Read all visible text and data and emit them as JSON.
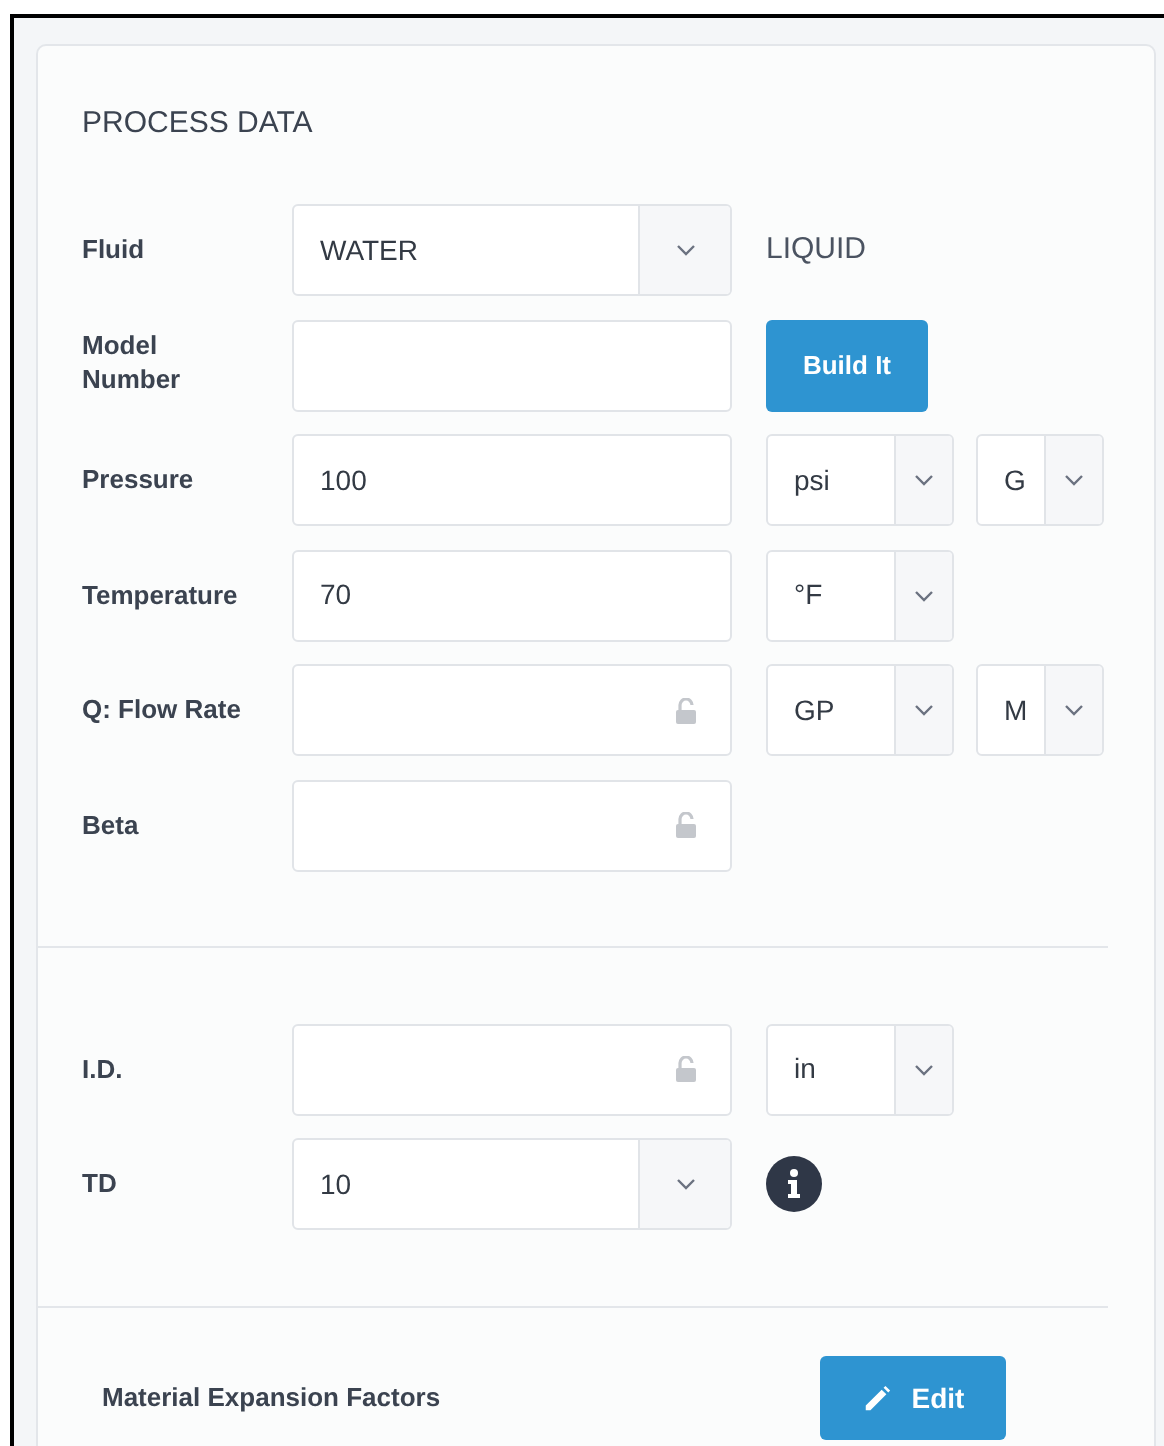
{
  "section_title": "PROCESS DATA",
  "rows": [
    {
      "label": "Fluid",
      "control": {
        "kind": "select",
        "value": "WATER"
      },
      "extras": [
        {
          "kind": "text",
          "text": "LIQUID"
        }
      ]
    },
    {
      "label": "Model Number",
      "control": {
        "kind": "input",
        "locked": false
      },
      "extras": [
        {
          "kind": "button",
          "text": "Build It"
        }
      ]
    },
    {
      "label": "Pressure",
      "control": {
        "kind": "input",
        "value": "100",
        "locked": false
      },
      "extras": [
        {
          "kind": "wide_select",
          "value": "psi"
        },
        {
          "kind": "narrow_select",
          "value": "G"
        }
      ]
    },
    {
      "label": "Temperature",
      "control": {
        "kind": "input",
        "value": "70",
        "locked": false
      },
      "extras": [
        {
          "kind": "wide_select",
          "value": "°F"
        }
      ]
    },
    {
      "label": "Q: Flow Rate",
      "control": {
        "kind": "input",
        "locked": true
      },
      "extras": [
        {
          "kind": "wide_select",
          "value": "GP"
        },
        {
          "kind": "narrow_select",
          "value": "M"
        }
      ]
    },
    {
      "label": "Beta",
      "control": {
        "kind": "input",
        "locked": true
      },
      "extras": []
    }
  ],
  "pipe_rows": [
    {
      "label": "I.D.",
      "control": {
        "kind": "input",
        "locked": true
      },
      "extras": [
        {
          "kind": "wide_select",
          "value": "in"
        }
      ]
    },
    {
      "label": "TD",
      "control": {
        "kind": "select",
        "value": "10"
      },
      "extras": [
        {
          "kind": "info"
        }
      ]
    }
  ],
  "material": {
    "label": "Material Expansion Factors",
    "button": "Edit"
  }
}
